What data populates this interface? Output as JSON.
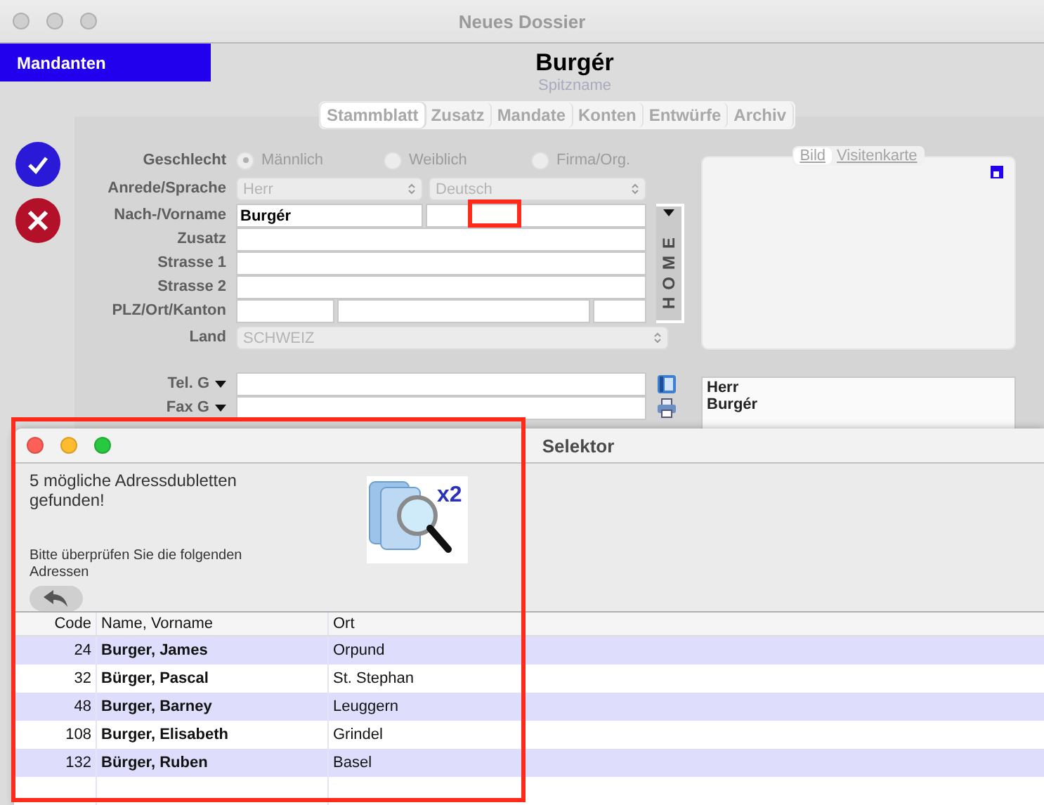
{
  "main_window": {
    "title": "Neues Dossier",
    "sidebar_label": "Mandanten",
    "header": {
      "name": "Burgér",
      "nickname_placeholder": "Spitzname"
    },
    "tabs": [
      {
        "label": "Stammblatt",
        "selected": true
      },
      {
        "label": "Zusatz",
        "selected": false
      },
      {
        "label": "Mandate",
        "selected": false
      },
      {
        "label": "Konten",
        "selected": false
      },
      {
        "label": "Entwürfe",
        "selected": false
      },
      {
        "label": "Archiv",
        "selected": false
      }
    ],
    "form": {
      "gender": {
        "label": "Geschlecht",
        "options": [
          {
            "label": "Männlich",
            "selected": true
          },
          {
            "label": "Weiblich",
            "selected": false
          },
          {
            "label": "Firma/Org.",
            "selected": false
          }
        ]
      },
      "salutation": {
        "label": "Anrede/Sprache",
        "salutation": "Herr",
        "language": "Deutsch"
      },
      "name": {
        "label": "Nach-/Vorname",
        "last_name": "Burgér"
      },
      "fields": [
        {
          "label": "Zusatz"
        },
        {
          "label": "Strasse 1"
        },
        {
          "label": "Strasse 2"
        }
      ],
      "plz": {
        "label": "PLZ/Ort/Kanton"
      },
      "country": {
        "label": "Land",
        "value": "SCHWEIZ"
      },
      "address_tab": "HOME"
    },
    "card_tabs": [
      {
        "label": "Bild",
        "selected": true
      },
      {
        "label": "Visitenkarte",
        "selected": false
      }
    ],
    "phones": [
      {
        "label": "Tel. G",
        "kind": "phone"
      },
      {
        "label": "Fax G",
        "kind": "fax"
      }
    ],
    "address_preview": [
      "Herr",
      "Burgér"
    ]
  },
  "selector_window": {
    "title": "Selektor",
    "message": "5 mögliche Adressdubletten gefunden!",
    "instruction": "Bitte überprüfen Sie die folgenden Adressen",
    "icon_badge": "x2",
    "table": {
      "columns": [
        "Code",
        "Name, Vorname",
        "Ort"
      ],
      "rows": [
        {
          "code": "24",
          "name": "Burger, James",
          "place": "Orpund"
        },
        {
          "code": "32",
          "name": "Bürger, Pascal",
          "place": "St. Stephan"
        },
        {
          "code": "48",
          "name": "Burger, Barney",
          "place": "Leuggern"
        },
        {
          "code": "108",
          "name": "Burger, Elisabeth",
          "place": "Grindel"
        },
        {
          "code": "132",
          "name": "Bürger, Ruben",
          "place": "Basel"
        }
      ]
    }
  }
}
